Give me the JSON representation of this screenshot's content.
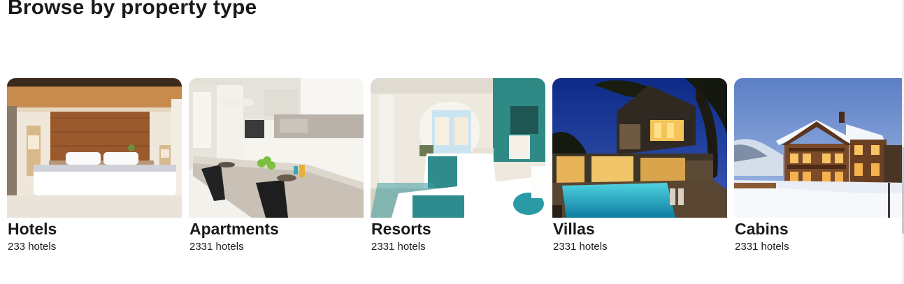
{
  "section": {
    "title": "Browse by property type"
  },
  "property_types": [
    {
      "name": "Hotels",
      "count": "233 hotels",
      "image": "hotel-bedroom-image"
    },
    {
      "name": "Apartments",
      "count": "2331 hotels",
      "image": "apartment-kitchen-image"
    },
    {
      "name": "Resorts",
      "count": "2331 hotels",
      "image": "resort-room-image"
    },
    {
      "name": "Villas",
      "count": "2331 hotels",
      "image": "villa-pool-image"
    },
    {
      "name": "Cabins",
      "count": "2331 hotels",
      "image": "snowy-cabin-image"
    }
  ]
}
